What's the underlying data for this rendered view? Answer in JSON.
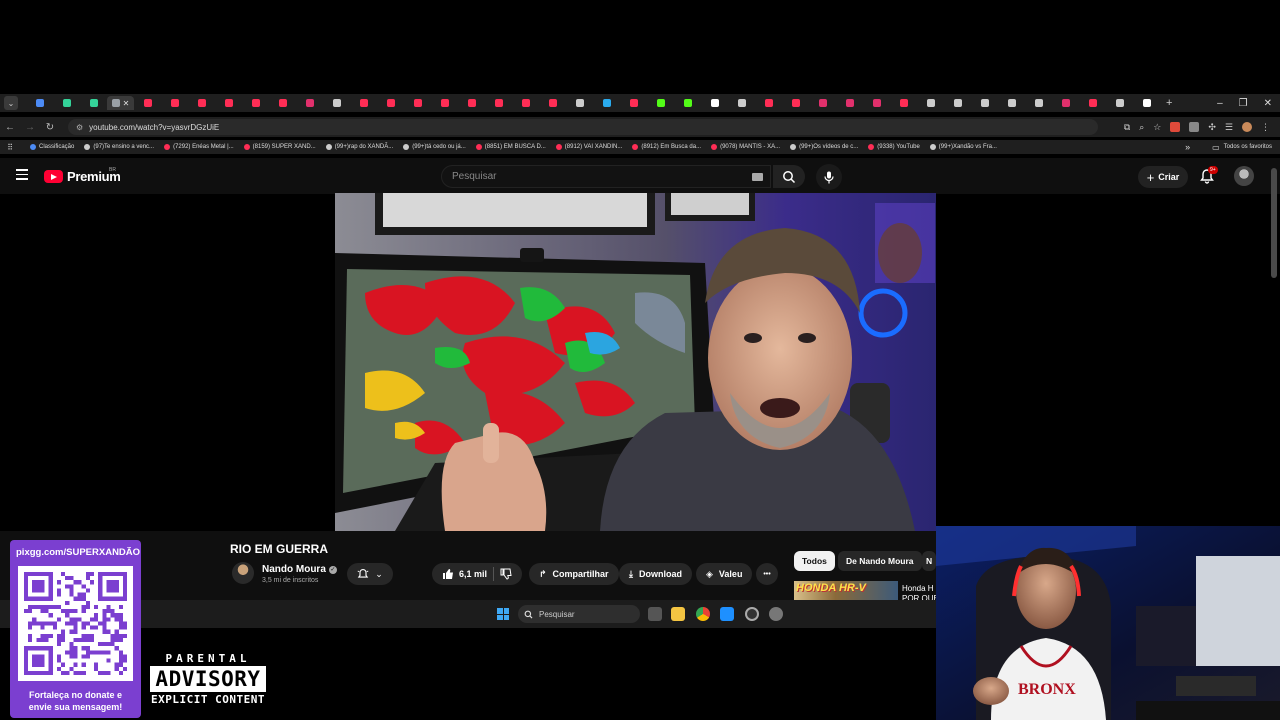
{
  "browser": {
    "active_tab_close": "✕",
    "new_tab": "+",
    "window_controls": [
      "–",
      "❐",
      "✕"
    ],
    "address": {
      "url": "youtube.com/watch?v=yasvrDGzUiE"
    },
    "tab_favicon_colors": [
      "#4c8bf5",
      "#34d399",
      "#34d399",
      "#9aa0a6",
      "#ff2d55",
      "#ff2d55",
      "#ff2d55",
      "#ff2d55",
      "#ff2d55",
      "#ff2d55",
      "#e1306c",
      "#cccccc",
      "#ff2d55",
      "#ff2d55",
      "#ff2d55",
      "#ff2d55",
      "#ff2d55",
      "#ff2d55",
      "#ff2d55",
      "#ff2d55",
      "#cccccc",
      "#2aabee",
      "#ff2d55",
      "#53fc18",
      "#53fc18",
      "#ffffff",
      "#cccccc",
      "#ff2d55",
      "#ff2d55",
      "#e1306c",
      "#e1306c",
      "#e1306c",
      "#ff2d55",
      "#cccccc",
      "#cccccc",
      "#cccccc",
      "#cccccc",
      "#cccccc",
      "#e1306c",
      "#ff2d55",
      "#cccccc",
      "#ffffff"
    ],
    "bookmarks": [
      {
        "label": "Classificação",
        "color": "#4c8bf5"
      },
      {
        "label": "(97)Te ensino a venc...",
        "color": "#cccccc"
      },
      {
        "label": "(7292) Enéas Metal |...",
        "color": "#ff2d55"
      },
      {
        "label": "(8159) SUPER XAND...",
        "color": "#ff2d55"
      },
      {
        "label": "(99+)rap do XANDÃ...",
        "color": "#cccccc"
      },
      {
        "label": "(99+)tá cedo ou já...",
        "color": "#cccccc"
      },
      {
        "label": "(8851) EM BUSCA D...",
        "color": "#ff2d55"
      },
      {
        "label": "(8912) VAI XANDIN...",
        "color": "#ff2d55"
      },
      {
        "label": "(8912) Em Busca da...",
        "color": "#ff2d55"
      },
      {
        "label": "(9078) MANTIS - XA...",
        "color": "#ff2d55"
      },
      {
        "label": "(99+)Os vídeos de c...",
        "color": "#cccccc"
      },
      {
        "label": "(9338) YouTube",
        "color": "#ff2d55"
      },
      {
        "label": "(99+)Xandão vs Fra...",
        "color": "#cccccc"
      }
    ],
    "bookmarks_more": "»",
    "all_bookmarks": "Todos os favoritos"
  },
  "youtube": {
    "logo_text": "Premium",
    "country_code": "BR",
    "search_placeholder": "Pesquisar",
    "create_label": "Criar",
    "notif_badge": "9+",
    "accent": "#ff0033"
  },
  "video": {
    "title": "RIO EM GUERRA",
    "channel": "Nando Moura",
    "subscribers": "3,5 mi de inscritos",
    "likes": "6,1 mil",
    "share": "Compartilhar",
    "download": "Download",
    "thanks": "Valeu",
    "more": "•••"
  },
  "recommendations": {
    "chips": [
      "Todos",
      "De Nando Moura",
      "N"
    ],
    "first_thumb_text": "HONDA HR-V",
    "first_title_line1": "Honda H",
    "first_title_line2": "POR QUE"
  },
  "taskbar": {
    "search_placeholder": "Pesquisar"
  },
  "overlay": {
    "pix_url": "pixgg.com/SUPERXANDÃO",
    "pix_caption_line1": "Fortaleça no donate e",
    "pix_caption_line2": "envie sua mensagem!",
    "advisory_line1": "PARENTAL",
    "advisory_line2": "ADVISORY",
    "advisory_line3": "EXPLICIT CONTENT",
    "pix_color": "#7b3fd0"
  }
}
